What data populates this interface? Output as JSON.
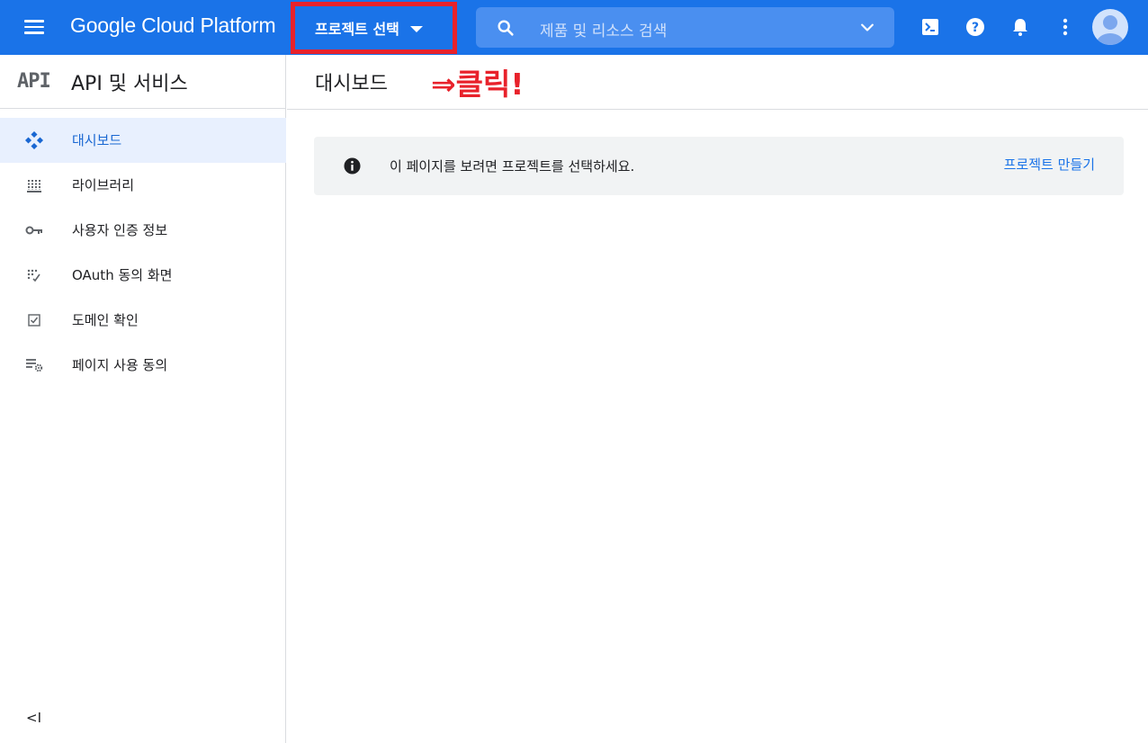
{
  "topbar": {
    "brand": "Google Cloud Platform",
    "project_select_label": "프로젝트 선택",
    "search_placeholder": "제품 및 리소스 검색",
    "icons": [
      "menu-icon",
      "cloud-shell-icon",
      "help-icon",
      "notifications-icon",
      "more-vert-icon",
      "account-avatar"
    ],
    "color": "#1a73e8",
    "highlight_color": "#e8222b"
  },
  "sidebar": {
    "logo": "API",
    "title": "API 및 서비스",
    "items": [
      {
        "label": "대시보드",
        "icon": "dashboard-icon",
        "active": true
      },
      {
        "label": "라이브러리",
        "icon": "library-icon",
        "active": false
      },
      {
        "label": "사용자 인증 정보",
        "icon": "key-icon",
        "active": false
      },
      {
        "label": "OAuth 동의 화면",
        "icon": "oauth-consent-icon",
        "active": false
      },
      {
        "label": "도메인 확인",
        "icon": "domain-check-icon",
        "active": false
      },
      {
        "label": "페이지 사용 동의",
        "icon": "page-usage-settings-icon",
        "active": false
      }
    ],
    "collapse_label": "<I"
  },
  "main": {
    "title": "대시보드",
    "annotation": "⇒클릭!",
    "banner": {
      "message": "이 페이지를 보려면 프로젝트를 선택하세요.",
      "link": "프로젝트 만들기"
    }
  }
}
